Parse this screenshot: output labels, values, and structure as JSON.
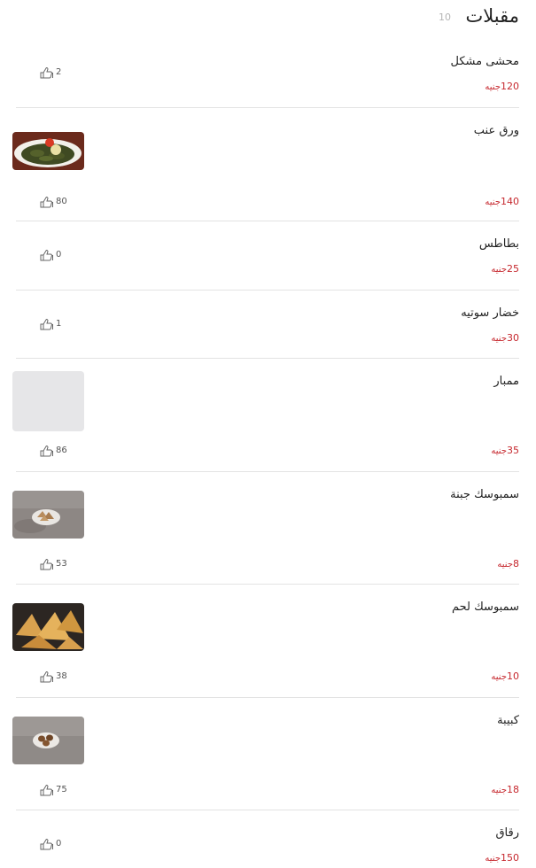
{
  "category": {
    "title": "مقبلات",
    "count": "10"
  },
  "currency": "جنيه",
  "items": [
    {
      "name": "محشى مشكل",
      "price": "120",
      "likes": "2",
      "image": null
    },
    {
      "name": "ورق عنب",
      "price": "140",
      "likes": "80",
      "image": "stuffed-grape-leaves-photo"
    },
    {
      "name": "بطاطس",
      "price": "25",
      "likes": "0",
      "image": null
    },
    {
      "name": "خضار سوتيه",
      "price": "30",
      "likes": "1",
      "image": null
    },
    {
      "name": "ممبار",
      "price": "35",
      "likes": "86",
      "image": "placeholder"
    },
    {
      "name": "سمبوسك جبنة",
      "price": "8",
      "likes": "53",
      "image": "cheese-sambousek-photo"
    },
    {
      "name": "سمبوسك لحم",
      "price": "10",
      "likes": "38",
      "image": "meat-sambousek-photo"
    },
    {
      "name": "كبيبة",
      "price": "18",
      "likes": "75",
      "image": "kobeba-photo"
    },
    {
      "name": "رقاق",
      "price": "150",
      "likes": "0",
      "image": null
    }
  ],
  "colors": {
    "price": "#c6282e",
    "divider": "#e3e3e3",
    "muted": "#b5b5b5"
  }
}
